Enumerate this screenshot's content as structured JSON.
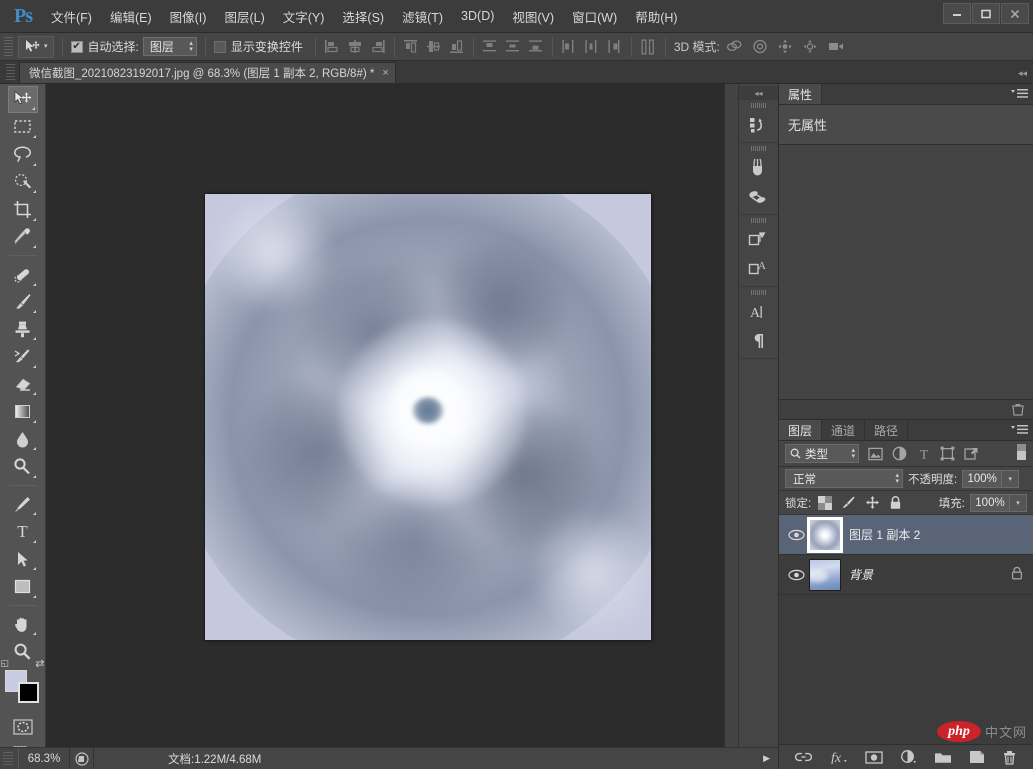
{
  "app": {
    "logo": "Ps",
    "menus": [
      {
        "label": "文件(F)",
        "name": "menu-file"
      },
      {
        "label": "编辑(E)",
        "name": "menu-edit"
      },
      {
        "label": "图像(I)",
        "name": "menu-image"
      },
      {
        "label": "图层(L)",
        "name": "menu-layer"
      },
      {
        "label": "文字(Y)",
        "name": "menu-type"
      },
      {
        "label": "选择(S)",
        "name": "menu-select"
      },
      {
        "label": "滤镜(T)",
        "name": "menu-filter"
      },
      {
        "label": "3D(D)",
        "name": "menu-3d"
      },
      {
        "label": "视图(V)",
        "name": "menu-view"
      },
      {
        "label": "窗口(W)",
        "name": "menu-window"
      },
      {
        "label": "帮助(H)",
        "name": "menu-help"
      }
    ],
    "window_controls": {
      "minimize": "—",
      "maximize": "❐",
      "close": "✕"
    }
  },
  "options_bar": {
    "tool_icon": "move-tool-icon",
    "auto_select_checked": true,
    "auto_select_label": "自动选择:",
    "auto_select_value": "图层",
    "show_transform_checked": false,
    "show_transform_label": "显示变换控件",
    "mode3d_label": "3D 模式:",
    "align_icons": [
      "align-left-edges",
      "align-horizontal-centers",
      "align-right-edges",
      "align-top-edges",
      "align-vertical-centers",
      "align-bottom-edges"
    ],
    "distribute_icons": [
      "distribute-top",
      "distribute-vertical-center",
      "distribute-bottom",
      "distribute-left",
      "distribute-horizontal-center",
      "distribute-right"
    ],
    "distribute_spacing_icon": "distribute-spacing",
    "mode3d_icons": [
      "3d-orbit",
      "3d-roll",
      "3d-pan",
      "3d-slide",
      "3d-camera"
    ]
  },
  "tab_bar": {
    "document_title": "微信截图_20210823192017.jpg @ 68.3% (图层 1 副本 2, RGB/8#) *",
    "close_glyph": "×",
    "collapse_glyph": "◂◂"
  },
  "toolbar": {
    "tools": [
      {
        "name": "move-tool",
        "active": true,
        "has_submenu": true
      },
      {
        "name": "rectangular-marquee-tool",
        "active": false,
        "has_submenu": true
      },
      {
        "name": "lasso-tool",
        "active": false,
        "has_submenu": true
      },
      {
        "name": "quick-selection-tool",
        "active": false,
        "has_submenu": true
      },
      {
        "name": "crop-tool",
        "active": false,
        "has_submenu": true
      },
      {
        "name": "eyedropper-tool",
        "active": false,
        "has_submenu": true
      },
      {
        "name": "spot-healing-brush-tool",
        "active": false,
        "has_submenu": true
      },
      {
        "name": "brush-tool",
        "active": false,
        "has_submenu": true
      },
      {
        "name": "clone-stamp-tool",
        "active": false,
        "has_submenu": true
      },
      {
        "name": "history-brush-tool",
        "active": false,
        "has_submenu": true
      },
      {
        "name": "eraser-tool",
        "active": false,
        "has_submenu": true
      },
      {
        "name": "gradient-tool",
        "active": false,
        "has_submenu": true
      },
      {
        "name": "blur-tool",
        "active": false,
        "has_submenu": true
      },
      {
        "name": "dodge-tool",
        "active": false,
        "has_submenu": true
      },
      {
        "name": "pen-tool",
        "active": false,
        "has_submenu": true
      },
      {
        "name": "horizontal-type-tool",
        "active": false,
        "has_submenu": true
      },
      {
        "name": "path-selection-tool",
        "active": false,
        "has_submenu": true
      },
      {
        "name": "rectangle-tool",
        "active": false,
        "has_submenu": true
      },
      {
        "name": "hand-tool",
        "active": false,
        "has_submenu": true
      },
      {
        "name": "zoom-tool",
        "active": false,
        "has_submenu": false
      }
    ],
    "foreground_color": "#c8cbe2",
    "background_color": "#000000",
    "quickmask_name": "quick-mask-mode",
    "screenmode_name": "screen-mode"
  },
  "icon_dock": {
    "items": [
      {
        "name": "history-panel-icon"
      },
      {
        "name": "brush-panel-icon"
      },
      {
        "name": "clone-source-panel-icon"
      },
      {
        "name": "adjustments-panel-icon"
      },
      {
        "name": "styles-panel-icon"
      },
      {
        "name": "character-panel-icon"
      },
      {
        "name": "paragraph-panel-icon"
      }
    ]
  },
  "properties_panel": {
    "tabs": [
      {
        "label": "属性",
        "active": true
      }
    ],
    "empty_message": "无属性"
  },
  "layers_panel": {
    "tabs": [
      {
        "label": "图层",
        "active": true
      },
      {
        "label": "通道",
        "active": false
      },
      {
        "label": "路径",
        "active": false
      }
    ],
    "filter_label": "类型",
    "filter_icons": [
      "filter-pixel",
      "filter-adjustment",
      "filter-type",
      "filter-shape",
      "filter-smart-object"
    ],
    "filter_toggle": "filter-enable-toggle",
    "blend_mode": "正常",
    "opacity_label": "不透明度:",
    "opacity_value": "100%",
    "lock_label": "锁定:",
    "lock_icons": [
      "lock-transparent-pixels",
      "lock-image-pixels",
      "lock-position",
      "lock-all"
    ],
    "fill_label": "填充:",
    "fill_value": "100%",
    "layers": [
      {
        "name": "图层 1 副本 2",
        "selected": true,
        "visible": true,
        "locked": false,
        "italic": false
      },
      {
        "name": "背景",
        "selected": false,
        "visible": true,
        "locked": true,
        "italic": true
      }
    ],
    "footer_icons": [
      "link-layers-icon",
      "add-layer-style-icon",
      "add-layer-mask-icon",
      "new-adjustment-layer-icon",
      "new-group-icon",
      "new-layer-icon",
      "delete-layer-icon"
    ]
  },
  "status_bar": {
    "zoom": "68.3%",
    "doc_info": "文档:1.22M/4.68M",
    "arrow_glyph": "▶",
    "preview_icon": "document-preview-icon"
  },
  "watermark": {
    "logo_text": "php",
    "label": "中文网"
  },
  "colors": {
    "chrome": "#535353",
    "panel": "#3c3c3c",
    "options_bar": "#454545",
    "canvas_bg": "#2c2c2c",
    "selection_blue": "#5a6477",
    "accent": "#3d8fc6",
    "watermark_red": "#cc2229"
  }
}
